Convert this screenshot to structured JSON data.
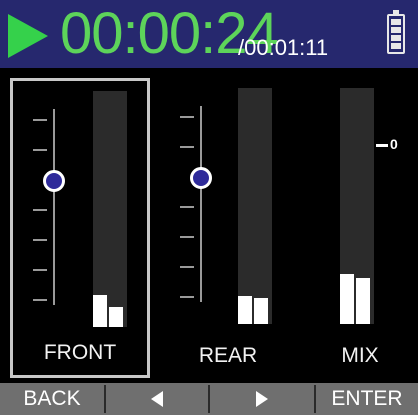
{
  "header": {
    "elapsed_time": "00:00:24",
    "total_time": "/00:01:11",
    "status": "playing",
    "battery_level_fraction": 1.0,
    "play_color": "#35d14b",
    "time_color": "#5dd45a",
    "background": "#26286e"
  },
  "channels": [
    {
      "label": "FRONT",
      "selected": true,
      "has_fader": true,
      "fader_level_fraction": 0.6,
      "meter_levels_fraction": [
        0.13,
        0.08
      ]
    },
    {
      "label": "REAR",
      "selected": false,
      "has_fader": true,
      "fader_level_fraction": 0.6,
      "meter_levels_fraction": [
        0.12,
        0.11
      ]
    },
    {
      "label": "MIX",
      "selected": false,
      "has_fader": false,
      "meter_levels_fraction": [
        0.21,
        0.19
      ],
      "scale_mark": "0"
    }
  ],
  "footer": {
    "back_label": "BACK",
    "left_icon": "left-arrow-icon",
    "right_icon": "right-arrow-icon",
    "enter_label": "ENTER"
  }
}
